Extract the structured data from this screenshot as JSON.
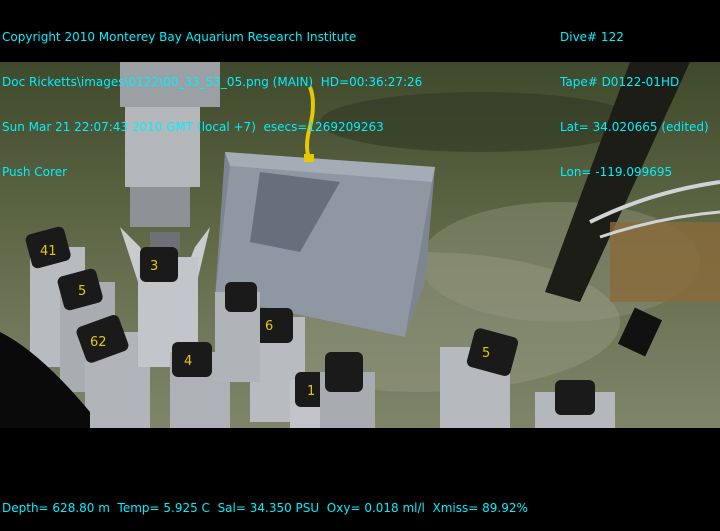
{
  "overlay": {
    "top_left": [
      "Copyright 2010 Monterey Bay Aquarium Research Institute",
      "Doc Ricketts\\images\\0122\\00_33_53_05.png (MAIN)  HD=00:36:27:26",
      "Sun Mar 21 22:07:43 2010 GMT (local +7)  esecs=1269209263",
      "Push Corer"
    ],
    "top_right": [
      "Dive# 122",
      "Tape# D0122-01HD",
      "Lat= 34.020665 (edited)",
      "Lon= -119.099695"
    ],
    "bottom": "Depth= 628.80 m  Temp= 5.925 C  Sal= 34.350 PSU  Oxy= 0.018 ml/l  Xmiss= 89.92%"
  },
  "core_labels": [
    "41",
    "5",
    "62",
    "3",
    "6",
    "4",
    "1",
    "5"
  ],
  "colors": {
    "overlay_text": "#00f0ff",
    "seafloor": "#6f7658",
    "box": "#8e96a2",
    "core_cap": "#1a1a1a",
    "tube": "#b8bcc0",
    "yellow_tag": "#e8c800"
  }
}
